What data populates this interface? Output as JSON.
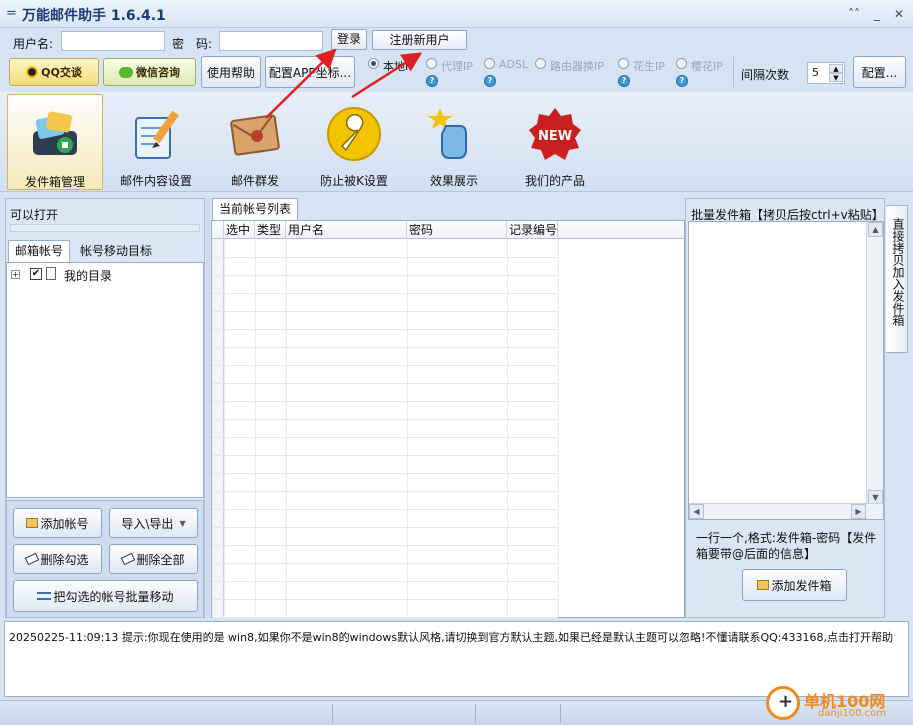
{
  "window": {
    "title": "万能邮件助手 1.6.4.1",
    "menu_glyph": "=",
    "pin_glyph": "˄˄",
    "minimize_glyph": "_",
    "close_glyph": "✕"
  },
  "login": {
    "username_label": "用户名:",
    "username_value": "",
    "password_label": "密　码:",
    "password_value": "",
    "login_button": "登录",
    "register_button": "注册新用户"
  },
  "toolbar": {
    "qq_button": "QQ交谈",
    "wechat_button": "微信咨询",
    "help_button": "使用帮助",
    "config_app_button": "配置APP坐标...",
    "ip_modes": [
      {
        "label": "本地IP",
        "selected": true
      },
      {
        "label": "代理IP",
        "selected": false
      },
      {
        "label": "ADSL",
        "selected": false
      },
      {
        "label": "路由器换IP",
        "selected": false
      },
      {
        "label": "花生IP",
        "selected": false
      },
      {
        "label": "樱花IP",
        "selected": false
      }
    ],
    "help_badge": "?",
    "interval_label": "间隔次数",
    "interval_value": "5",
    "config_button": "配置..."
  },
  "main_tabs": [
    {
      "label": "发件箱管理",
      "icon": "mailbox-icon",
      "active": true
    },
    {
      "label": "邮件内容设置",
      "icon": "notepad-pencil-icon",
      "active": false
    },
    {
      "label": "邮件群发",
      "icon": "envelope-icon",
      "active": false
    },
    {
      "label": "防止被K设置",
      "icon": "wrench-icon",
      "active": false
    },
    {
      "label": "效果展示",
      "icon": "click-hand-icon",
      "active": false
    },
    {
      "label": "我们的产品",
      "icon": "new-badge-icon",
      "active": false
    }
  ],
  "new_badge_text": "NEW",
  "left_panel": {
    "header": "可以打开",
    "tabs": [
      "邮箱帐号",
      "帐号移动目标"
    ],
    "tree_root": "我的目录",
    "tree_expand_glyph": "+",
    "tree_check_glyph": "✔",
    "buttons": {
      "add_account": "添加帐号",
      "import_export": "导入\\导出",
      "delete_checked": "删除勾选",
      "delete_all": "删除全部",
      "batch_move": "把勾选的帐号批量移动"
    }
  },
  "center_panel": {
    "tab": "当前帐号列表",
    "columns": [
      "选中",
      "类型",
      "用户名",
      "密码",
      "记录编号"
    ]
  },
  "right_panel": {
    "header": "批量发件箱【拷贝后按ctrl+v粘贴】",
    "side_tab": "直接拷贝加入发件箱",
    "hint": "一行一个,格式:发件箱-密码【发件箱要带@后面的信息】",
    "add_button": "添加发件箱"
  },
  "log": {
    "line": "20250225-11:09:13  提示:你现在使用的是 win8,如果你不是win8的windows默认风格,请切换到官方默认主题,如果已经是默认主题可以忽略!不懂请联系QQ:433168,点击打开帮助"
  },
  "watermark": {
    "site": "单机100网",
    "domain": "danji100.com"
  },
  "colors": {
    "accent": "#1a3c72",
    "active_tab": "#f6e8b8",
    "arrow": "#e02020"
  }
}
